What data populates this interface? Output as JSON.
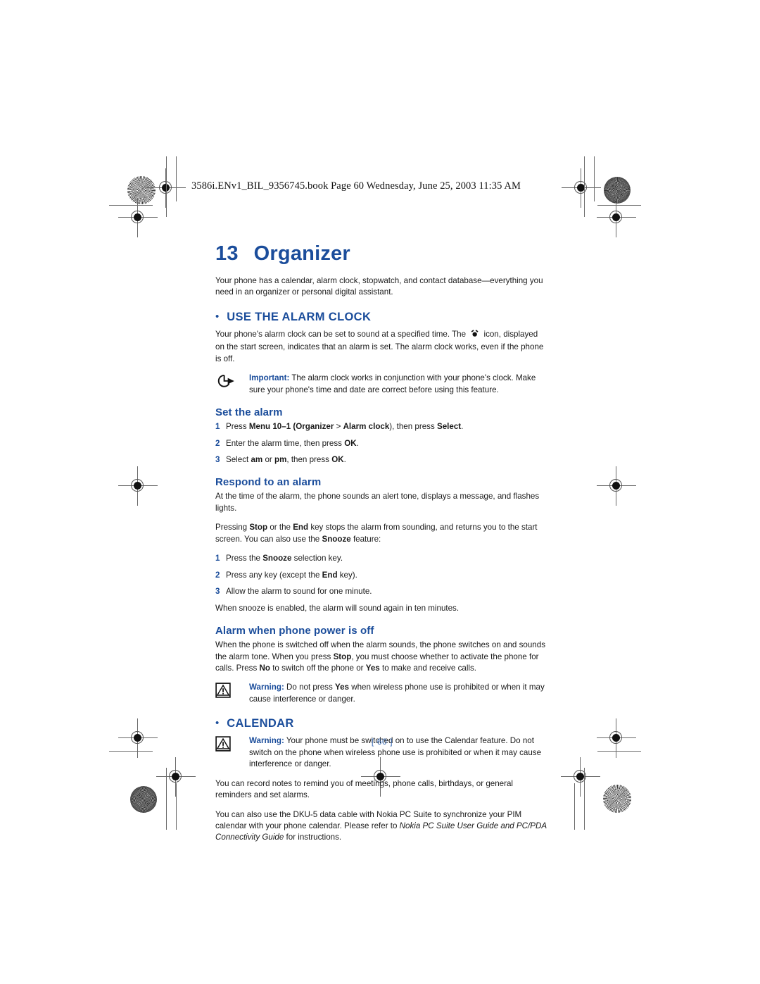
{
  "document": {
    "slug_line": "3586i.ENv1_BIL_9356745.book  Page 60  Wednesday, June 25, 2003  11:35 AM",
    "folio": "[ 60 ]"
  },
  "chapter": {
    "number": "13",
    "title": "Organizer",
    "intro": "Your phone has a calendar, alarm clock, stopwatch, and contact database—everything you need in an organizer or personal digital assistant."
  },
  "sections": [
    {
      "id": "use-the-alarm-clock",
      "heading": "USE THE ALARM CLOCK",
      "intro_before_icon": "Your phone's alarm clock can be set to sound at a specified time. The ",
      "inline_icon": "alarm-clock-icon",
      "intro_after_icon": " icon, displayed on the start screen, indicates that an alarm is set. The alarm clock works, even if the phone is off.",
      "note": {
        "icon": "important-circle-arrow-icon",
        "lead": "Important:",
        "text": " The alarm clock works in conjunction with your phone's clock. Make sure your phone's time and date are correct before using this feature."
      },
      "subsections": [
        {
          "id": "set-the-alarm",
          "heading": "Set the alarm",
          "steps": [
            {
              "n": "1",
              "parts": [
                {
                  "t": "Press ",
                  "b": false
                },
                {
                  "t": "Menu 10–1 (Organizer",
                  "b": true
                },
                {
                  "t": " > ",
                  "b": false
                },
                {
                  "t": "Alarm clock",
                  "b": true
                },
                {
                  "t": "), then press ",
                  "b": false
                },
                {
                  "t": "Select",
                  "b": true
                },
                {
                  "t": ".",
                  "b": false
                }
              ]
            },
            {
              "n": "2",
              "parts": [
                {
                  "t": "Enter the alarm time, then press ",
                  "b": false
                },
                {
                  "t": "OK",
                  "b": true
                },
                {
                  "t": ".",
                  "b": false
                }
              ]
            },
            {
              "n": "3",
              "parts": [
                {
                  "t": "Select ",
                  "b": false
                },
                {
                  "t": "am",
                  "b": true
                },
                {
                  "t": " or ",
                  "b": false
                },
                {
                  "t": "pm",
                  "b": true
                },
                {
                  "t": ", then press ",
                  "b": false
                },
                {
                  "t": "OK",
                  "b": true
                },
                {
                  "t": ".",
                  "b": false
                }
              ]
            }
          ]
        },
        {
          "id": "respond-to-an-alarm",
          "heading": "Respond to an alarm",
          "paragraphs": [
            [
              {
                "t": "At the time of the alarm, the phone sounds an alert tone, displays a message, and flashes lights.",
                "b": false
              }
            ],
            [
              {
                "t": "Pressing ",
                "b": false
              },
              {
                "t": "Stop",
                "b": true
              },
              {
                "t": " or the ",
                "b": false
              },
              {
                "t": "End",
                "b": true
              },
              {
                "t": " key stops the alarm from sounding, and returns you to the start screen. You can also use the ",
                "b": false
              },
              {
                "t": "Snooze",
                "b": true
              },
              {
                "t": " feature:",
                "b": false
              }
            ]
          ],
          "steps": [
            {
              "n": "1",
              "parts": [
                {
                  "t": "Press the ",
                  "b": false
                },
                {
                  "t": "Snooze",
                  "b": true
                },
                {
                  "t": " selection key.",
                  "b": false
                }
              ]
            },
            {
              "n": "2",
              "parts": [
                {
                  "t": "Press any key (except the ",
                  "b": false
                },
                {
                  "t": "End",
                  "b": true
                },
                {
                  "t": " key).",
                  "b": false
                }
              ]
            },
            {
              "n": "3",
              "parts": [
                {
                  "t": "Allow the alarm to sound for one minute.",
                  "b": false
                }
              ]
            }
          ],
          "closing": "When snooze is enabled, the alarm will sound again in ten minutes."
        },
        {
          "id": "alarm-when-phone-power-is-off",
          "heading": "Alarm when phone power is off",
          "paragraphs": [
            [
              {
                "t": "When the phone is switched off when the alarm sounds, the phone switches on and sounds the alarm tone. When you press ",
                "b": false
              },
              {
                "t": "Stop",
                "b": true
              },
              {
                "t": ", you must choose whether to activate the phone for calls. Press ",
                "b": false
              },
              {
                "t": "No",
                "b": true
              },
              {
                "t": " to switch off the phone or ",
                "b": false
              },
              {
                "t": "Yes",
                "b": true
              },
              {
                "t": " to make and receive calls.",
                "b": false
              }
            ]
          ],
          "note": {
            "icon": "warning-triangle-icon",
            "lead": "Warning:",
            "parts": [
              {
                "t": " Do not press ",
                "b": false
              },
              {
                "t": "Yes",
                "b": true
              },
              {
                "t": " when wireless phone use is prohibited or when it may cause interference or danger.",
                "b": false
              }
            ]
          }
        }
      ]
    },
    {
      "id": "calendar",
      "heading": "CALENDAR",
      "note": {
        "icon": "warning-triangle-icon",
        "lead": "Warning:",
        "text": " Your phone must be switched on to use the Calendar feature. Do not switch on the phone when wireless phone use is prohibited or when it may cause interference or danger."
      },
      "paragraphs": [
        [
          {
            "t": "You can record notes to remind you of meetings, phone calls, birthdays, or general reminders and set alarms.",
            "b": false
          }
        ],
        [
          {
            "t": "You can also use the DKU-5 data cable with Nokia PC Suite to synchronize your PIM calendar with your phone calendar. Please refer to ",
            "b": false
          },
          {
            "t": "Nokia PC Suite User Guide and PC/PDA Connectivity Guide",
            "i": true
          },
          {
            "t": " for instructions.",
            "b": false
          }
        ]
      ]
    }
  ],
  "colors": {
    "heading_blue": "#1b4d9b",
    "folio_blue": "#3b6cb5",
    "body_black": "#1a1a1a"
  }
}
